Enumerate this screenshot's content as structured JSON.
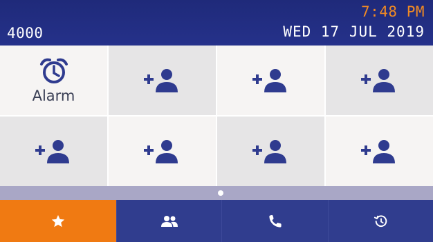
{
  "header": {
    "extension": "4000",
    "time": "7:48 PM",
    "date": "WED 17 JUL 2019"
  },
  "grid": {
    "cells": [
      {
        "type": "alarm",
        "label": "Alarm",
        "icon": "alarm-clock-icon"
      },
      {
        "type": "empty",
        "icon": "add-contact-icon"
      },
      {
        "type": "empty",
        "icon": "add-contact-icon"
      },
      {
        "type": "empty",
        "icon": "add-contact-icon"
      },
      {
        "type": "empty",
        "icon": "add-contact-icon"
      },
      {
        "type": "empty",
        "icon": "add-contact-icon"
      },
      {
        "type": "empty",
        "icon": "add-contact-icon"
      },
      {
        "type": "empty",
        "icon": "add-contact-icon"
      }
    ]
  },
  "pager": {
    "pages": 1,
    "current": 1
  },
  "bottom_bar": {
    "tabs": [
      {
        "name": "favorites",
        "icon": "star-icon",
        "active": true
      },
      {
        "name": "contacts",
        "icon": "people-icon",
        "active": false
      },
      {
        "name": "phone",
        "icon": "phone-icon",
        "active": false
      },
      {
        "name": "history",
        "icon": "history-icon",
        "active": false
      }
    ]
  },
  "colors": {
    "header_bg": "#25318a",
    "time_text": "#f08a24",
    "accent_orange": "#f07a12",
    "icon_blue": "#2f3b8f",
    "bottom_bar_bg": "#303d8e",
    "pager_bg": "#a9a7c6"
  }
}
